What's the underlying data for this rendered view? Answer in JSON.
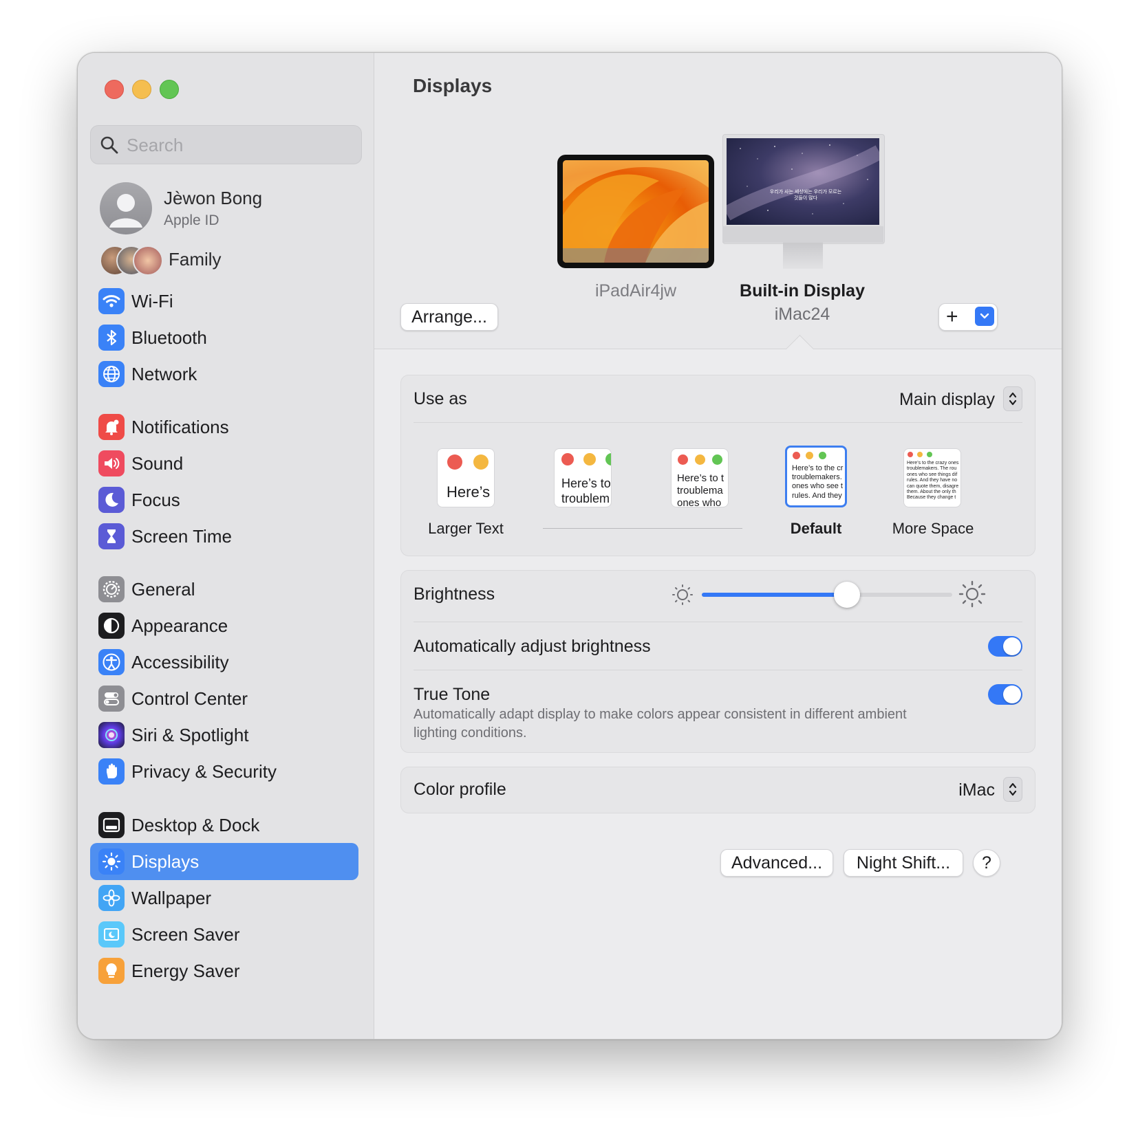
{
  "sidebar": {
    "search_placeholder": "Search",
    "account": {
      "name": "Jèwon Bong",
      "subtitle": "Apple ID"
    },
    "family_label": "Family",
    "items": [
      {
        "label": "Wi-Fi",
        "icon": "wifi-icon",
        "color": "#3a82f7"
      },
      {
        "label": "Bluetooth",
        "icon": "bluetooth-icon",
        "color": "#3a82f7"
      },
      {
        "label": "Network",
        "icon": "globe-icon",
        "color": "#3a82f7"
      },
      {
        "label": "Notifications",
        "icon": "bell-icon",
        "color": "#ef4b47"
      },
      {
        "label": "Sound",
        "icon": "speaker-icon",
        "color": "#ef4b5f"
      },
      {
        "label": "Focus",
        "icon": "moon-icon",
        "color": "#5b5bd6"
      },
      {
        "label": "Screen Time",
        "icon": "hourglass-icon",
        "color": "#5b5bd6"
      },
      {
        "label": "General",
        "icon": "gear-icon",
        "color": "#8e8e93"
      },
      {
        "label": "Appearance",
        "icon": "appearance-icon",
        "color": "#1d1d1f"
      },
      {
        "label": "Accessibility",
        "icon": "accessibility-icon",
        "color": "#3a82f7"
      },
      {
        "label": "Control Center",
        "icon": "control-center-icon",
        "color": "#8e8e93"
      },
      {
        "label": "Siri & Spotlight",
        "icon": "siri-icon",
        "color": "#6c3fd1"
      },
      {
        "label": "Privacy & Security",
        "icon": "hand-icon",
        "color": "#3a82f7"
      },
      {
        "label": "Desktop & Dock",
        "icon": "dock-icon",
        "color": "#1d1d1f"
      },
      {
        "label": "Displays",
        "icon": "sun-icon",
        "color": "#3a82f7",
        "active": true
      },
      {
        "label": "Wallpaper",
        "icon": "flower-icon",
        "color": "#42a5f5"
      },
      {
        "label": "Screen Saver",
        "icon": "screen-saver-icon",
        "color": "#5ac8fa"
      },
      {
        "label": "Energy Saver",
        "icon": "bulb-icon",
        "color": "#f7a13a"
      }
    ]
  },
  "main": {
    "title": "Displays",
    "arrange_label": "Arrange...",
    "displays": [
      {
        "name": "iPadAir4jw",
        "subtitle": ""
      },
      {
        "name": "Built-in Display",
        "subtitle": "iMac24",
        "selected": true
      }
    ],
    "add_label": "+",
    "use_as": {
      "label": "Use as",
      "value": "Main display"
    },
    "resolution": {
      "options": [
        "Larger Text",
        "",
        "",
        "Default",
        "More Space"
      ],
      "selected": "Default",
      "preview_text": "Here’s to the crazy ones, the troublemakers. The round pegs in the square holes. The ones who see things differently. They’re not fond of rules. And they have no respect for the status quo. You can quote them, disagree with them. About the only thing you can’t do is ignore them. Because they change things.",
      "previews": [
        "Here’s",
        "Here’s to troublem",
        "Here’s to t troublema ones who",
        "Here’s to the cr troublemakers. ones who see t rules. And they",
        "Here’s to the crazy ones troublemakers. The rou ones who see things dif rules. And they have no can quote them, disagre them. About the only th Because they change t"
      ]
    },
    "brightness": {
      "label": "Brightness",
      "value": 0.58
    },
    "auto_brightness": {
      "label": "Automatically adjust brightness",
      "on": true
    },
    "true_tone": {
      "label": "True Tone",
      "description": "Automatically adapt display to make colors appear consistent in different ambient lighting conditions.",
      "on": true
    },
    "color_profile": {
      "label": "Color profile",
      "value": "iMac"
    },
    "buttons": {
      "advanced": "Advanced...",
      "night_shift": "Night Shift...",
      "help": "?"
    },
    "imac_wallpaper_text": "우리가 사는 세상에는 우리가 모르는 것들이 많다"
  },
  "colors": {
    "accent": "#3478f6",
    "sidebar_active": "#4f8ff0"
  }
}
